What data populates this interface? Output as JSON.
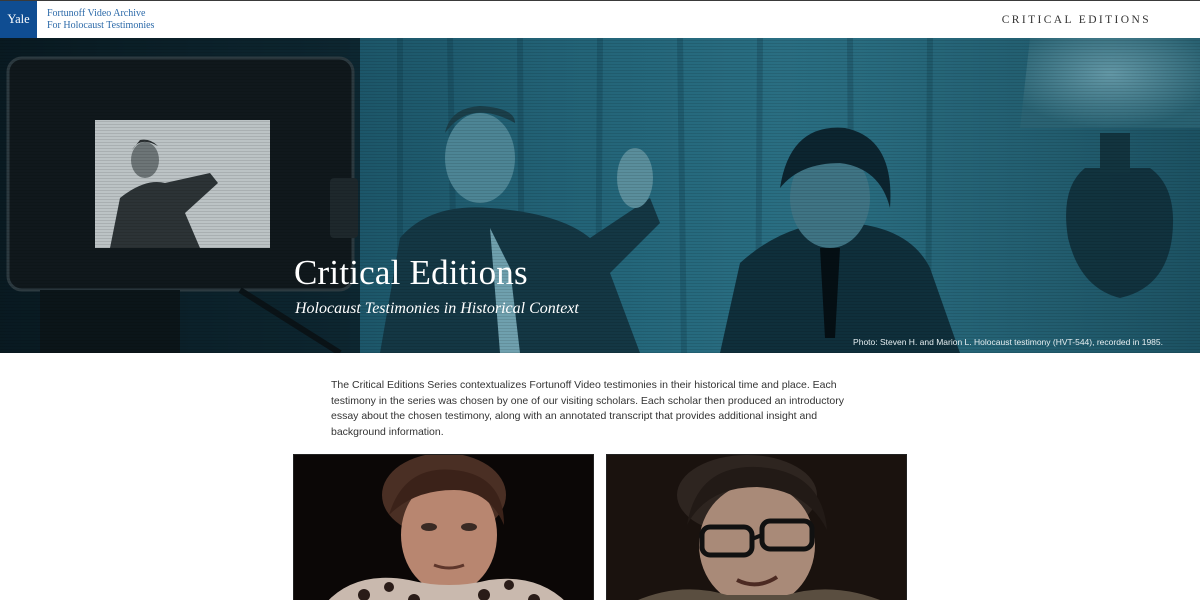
{
  "header": {
    "logo_text": "Yale",
    "archive_line1": "Fortunoff Video Archive",
    "archive_line2": "For Holocaust Testimonies",
    "nav_title": "CRITICAL EDITIONS"
  },
  "hero": {
    "title": "Critical Editions",
    "subtitle": "Holocaust Testimonies in Historical Context",
    "photo_credit": "Photo: Steven H. and Marion L. Holocaust testimony (HVT-544), recorded in 1985."
  },
  "intro": {
    "text": "The Critical Editions Series contextualizes Fortunoff Video testimonies in their historical time and place. Each testimony in the series was chosen by one of our visiting scholars. Each scholar then produced an introductory essay about the chosen testimony, along with an annotated transcript that provides additional insight and background information."
  },
  "colors": {
    "yale_blue": "#0f4d92",
    "link_blue": "#2c6aa9",
    "hero_teal": "#1c5a6e",
    "body_text": "#333333"
  }
}
